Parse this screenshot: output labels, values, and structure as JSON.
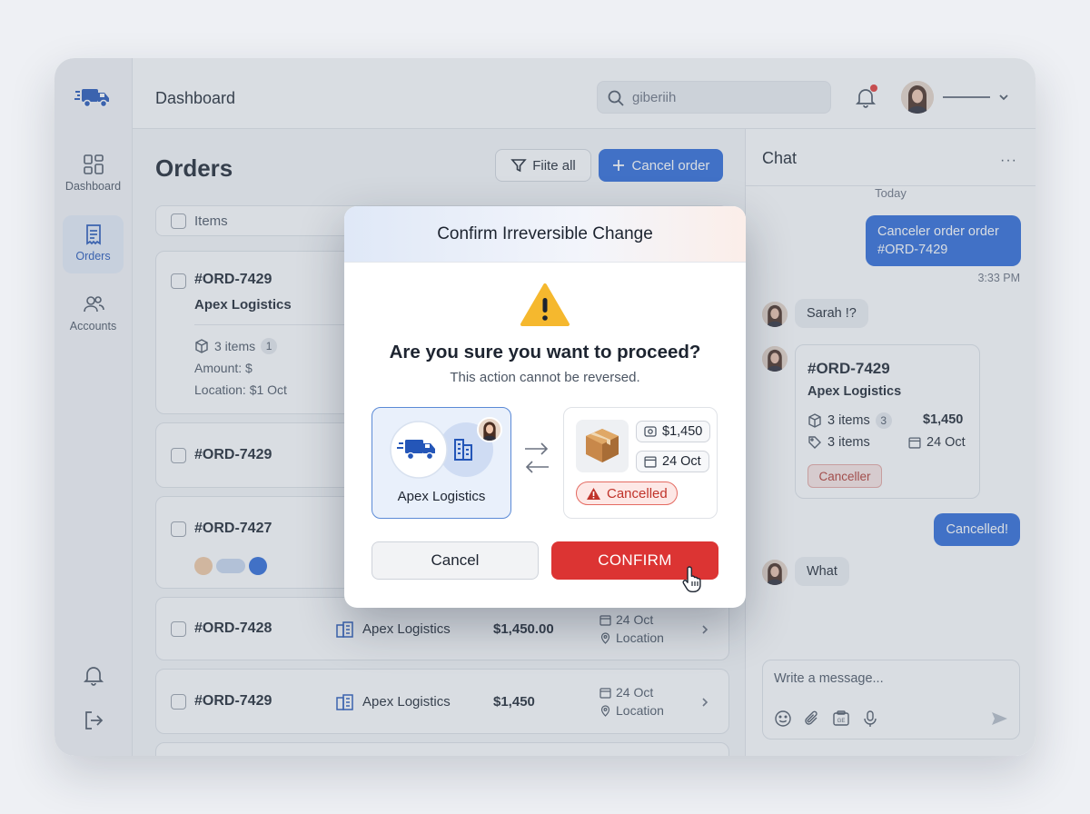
{
  "topbar": {
    "title": "Dashboard",
    "search_value": "giberiih"
  },
  "sidebar": {
    "items": [
      {
        "label": "Dashboard"
      },
      {
        "label": "Orders"
      },
      {
        "label": "Accounts"
      }
    ]
  },
  "orders": {
    "title": "Orders",
    "filter_label": "Fiite all",
    "cancel_order_label": "Cancel order",
    "list_header": "Items",
    "cards": [
      {
        "id": "#ORD-7429",
        "company": "Apex Logistics",
        "items": "3 items",
        "items_count": "1",
        "amount": "Amount: $",
        "location": "Location: $1 Oct"
      },
      {
        "id": "#ORD-7429"
      },
      {
        "id": "#ORD-7427"
      },
      {
        "id": "#ORD-7428",
        "company": "Apex Logistics",
        "amount": "$1,450.00",
        "date": "24 Oct",
        "location": "Location"
      },
      {
        "id": "#ORD-7429",
        "company": "Apex Logistics",
        "amount": "$1,450",
        "date": "24 Oct",
        "location": "Location"
      }
    ]
  },
  "chat": {
    "title": "Chat",
    "more": "···",
    "today": "Today",
    "msg1": "Canceler order order #ORD-7429",
    "msg1_time": "3:33 PM",
    "msg2": "Sarah !?",
    "card": {
      "id": "#ORD-7429",
      "company": "Apex Logistics",
      "items1": "3 items",
      "count": "3",
      "amount": "$1,450",
      "items2": "3 items",
      "date": "24 Oct",
      "button": "Canceller"
    },
    "msg3": "Cancelled!",
    "msg4": "What",
    "composer_placeholder": "Write a message..."
  },
  "modal": {
    "title": "Confirm Irreversible Change",
    "question": "Are you sure you want to proceed?",
    "subtitle": "This action cannot be reversed.",
    "company": "Apex Logistics",
    "amount": "$1,450",
    "date": "24 Oct",
    "status": "Cancelled",
    "cancel_label": "Cancel",
    "confirm_label": "CONFIRM"
  },
  "colors": {
    "accent": "#2d6ad8",
    "danger": "#dc3433",
    "warning": "#f5b82e"
  }
}
